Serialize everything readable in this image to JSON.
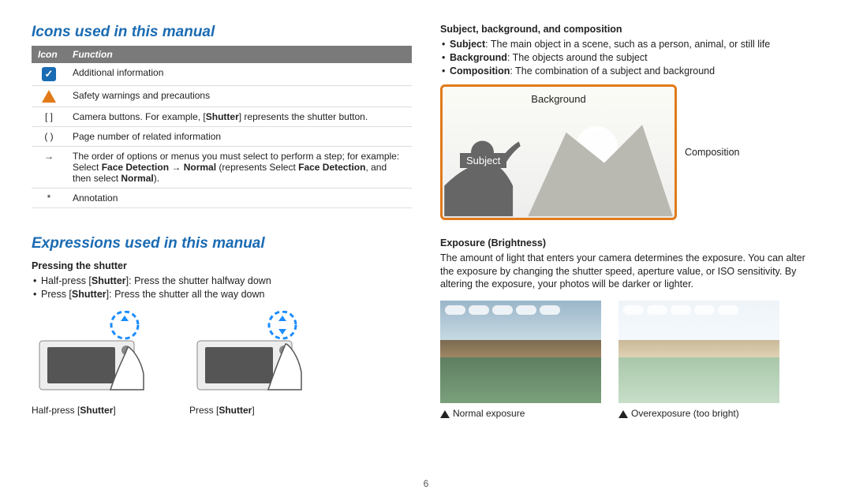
{
  "page_number": "6",
  "left": {
    "heading1": "Icons used in this manual",
    "table": {
      "head_icon": "Icon",
      "head_function": "Function",
      "rows": [
        {
          "icon": "info",
          "text": "Additional information"
        },
        {
          "icon": "warn",
          "text": "Safety warnings and precautions"
        },
        {
          "icon": "[ ]",
          "text_html": "Camera buttons. For example, [<b>Shutter</b>] represents the shutter button."
        },
        {
          "icon": "( )",
          "text": "Page number of related information"
        },
        {
          "icon": "→",
          "text_html": "The order of options or menus you must select to perform a step; for example: Select <b>Face Detection</b> → <b>Normal</b> (represents Select <b>Face Detection</b>, and then select <b>Normal</b>)."
        },
        {
          "icon": "*",
          "text": "Annotation"
        }
      ]
    },
    "heading2": "Expressions used in this manual",
    "sub1": "Pressing the shutter",
    "bullets1": [
      "Half-press [<b>Shutter</b>]: Press the shutter halfway down",
      "Press [<b>Shutter</b>]: Press the shutter all the way down"
    ],
    "cap_half": "Half-press [<b>Shutter</b>]",
    "cap_full": "Press [<b>Shutter</b>]"
  },
  "right": {
    "sub_compo": "Subject, background, and composition",
    "compo_bullets": [
      "<b>Subject</b>: The main object in a scene, such as a person, animal, or still life",
      "<b>Background</b>: The objects around the subject",
      "<b>Composition</b>: The combination of a subject and background"
    ],
    "label_background": "Background",
    "label_subject": "Subject",
    "label_composition": "Composition",
    "sub_exposure": "Exposure (Brightness)",
    "exposure_text": "The amount of light that enters your camera determines the exposure. You can alter the exposure by changing the shutter speed, aperture value, or ISO sensitivity. By altering the exposure, your photos will be darker or lighter.",
    "cap_normal": "Normal exposure",
    "cap_over": "Overexposure (too bright)"
  }
}
